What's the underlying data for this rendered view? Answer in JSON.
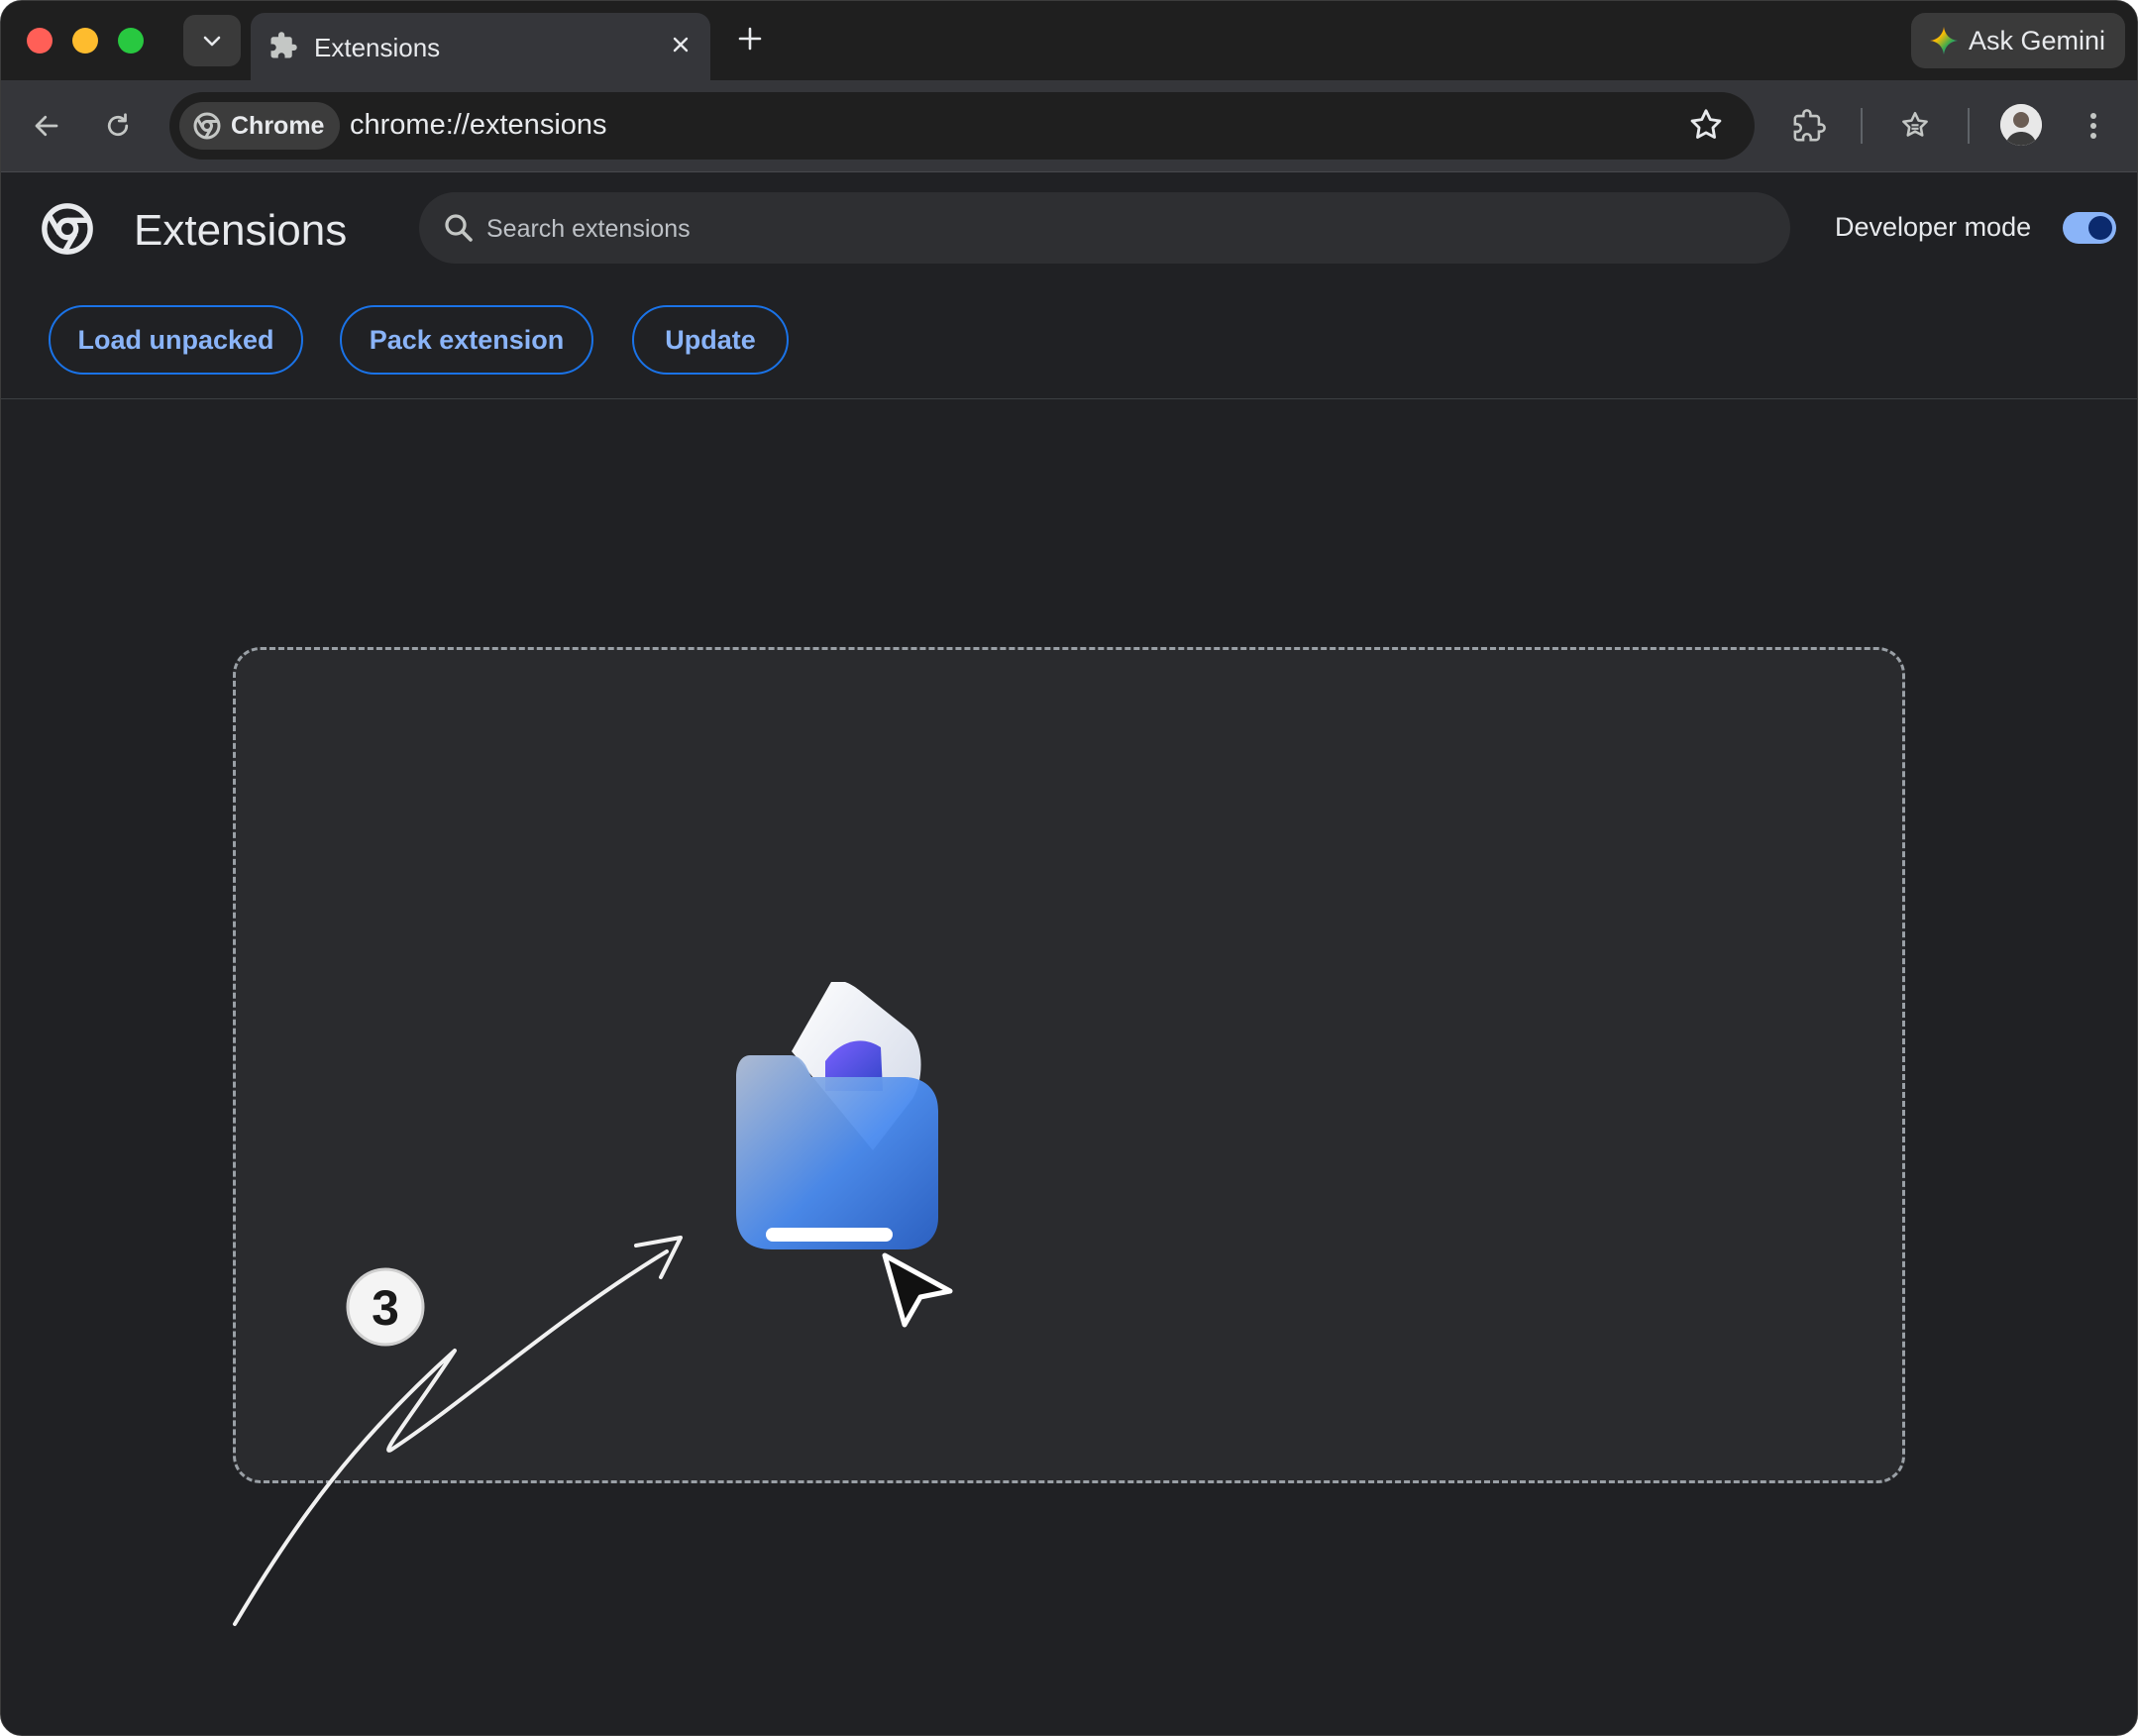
{
  "window": {
    "tab_title": "Extensions",
    "gemini_label": "Ask Gemini"
  },
  "toolbar": {
    "chip_label": "Chrome",
    "url": "chrome://extensions"
  },
  "page": {
    "title": "Extensions",
    "search_placeholder": "Search extensions",
    "developer_mode_label": "Developer mode",
    "developer_mode_on": true,
    "buttons": {
      "load_unpacked": "Load unpacked",
      "pack_extension": "Pack extension",
      "update": "Update"
    }
  },
  "annotation": {
    "step_number": "3"
  },
  "colors": {
    "accent": "#8ab4f8",
    "button_border": "#1a73e8",
    "background": "#202124"
  },
  "icons": [
    "chevron-down-icon",
    "puzzle-icon",
    "close-icon",
    "plus-icon",
    "gemini-spark-icon",
    "back-arrow-icon",
    "reload-icon",
    "chrome-logo-icon",
    "star-icon",
    "extensions-icon",
    "reading-list-icon",
    "avatar",
    "more-vert-icon",
    "search-icon",
    "folder-icon",
    "cursor-icon"
  ]
}
